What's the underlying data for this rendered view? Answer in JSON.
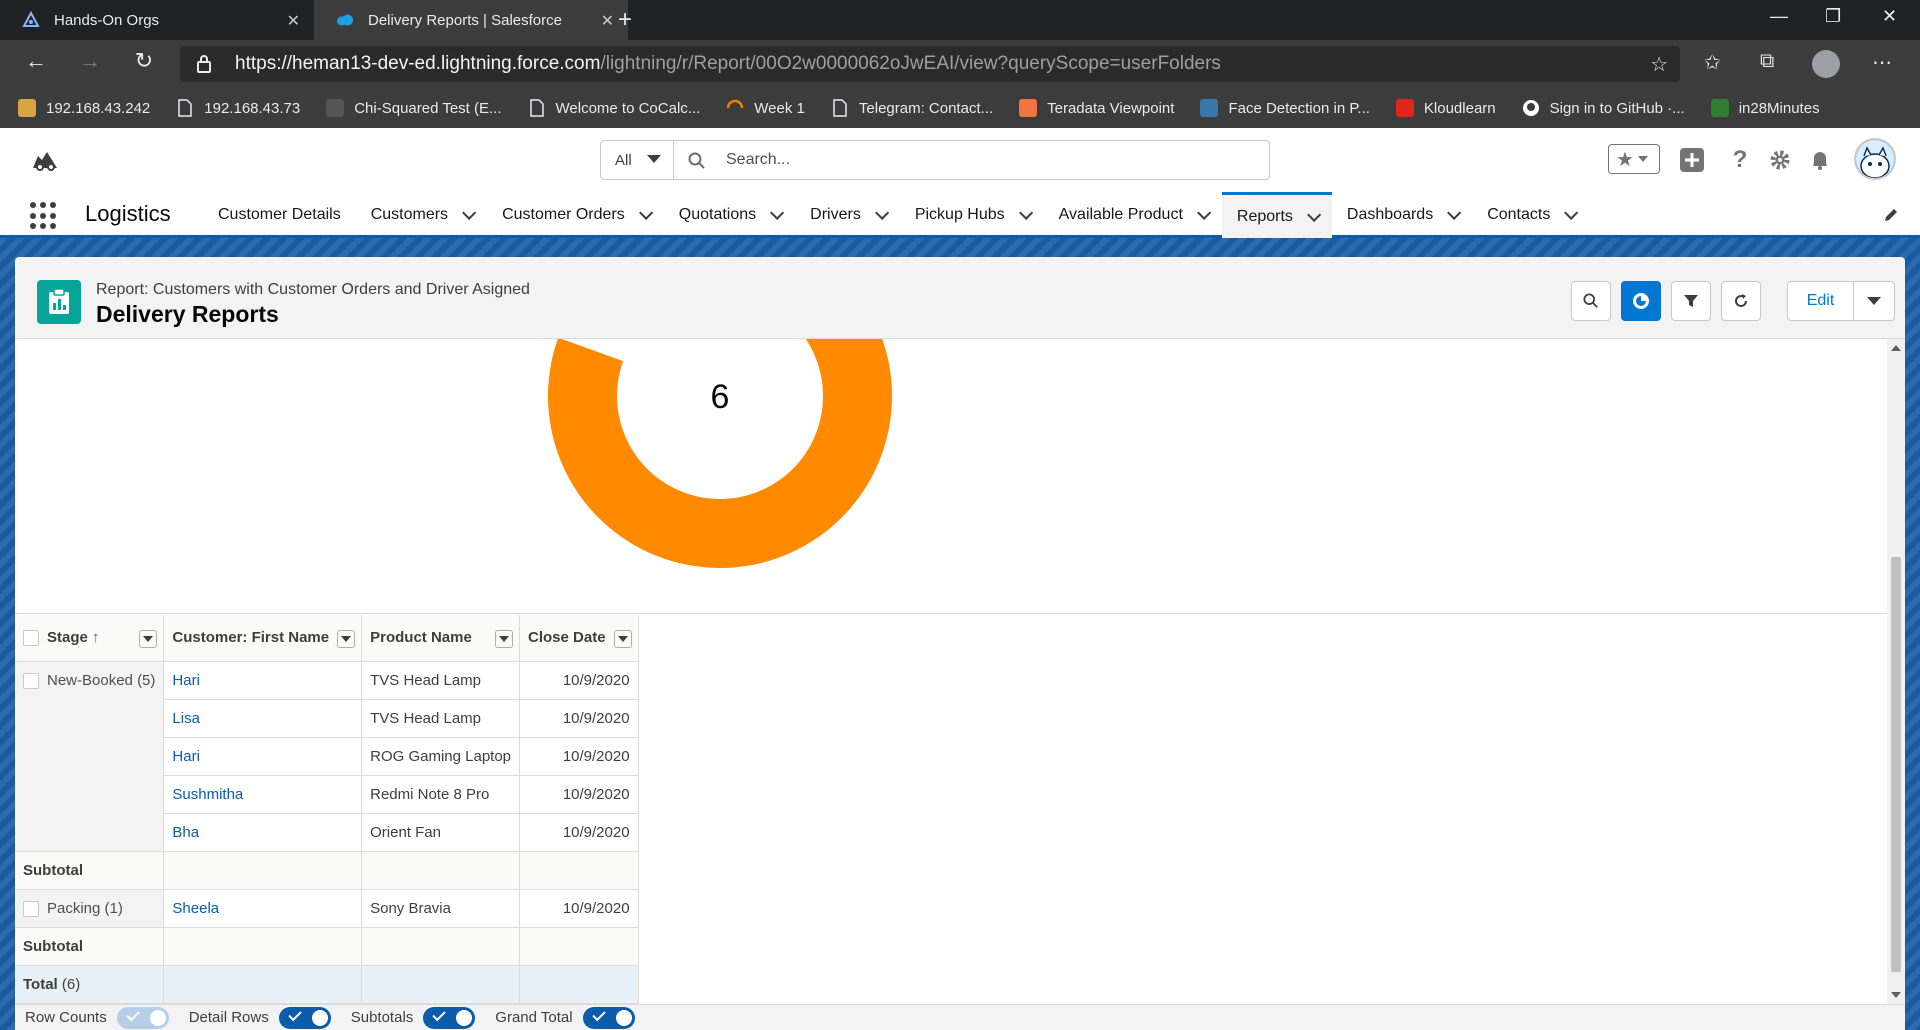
{
  "browser": {
    "tabs": [
      {
        "title": "Hands-On Orgs",
        "active": false
      },
      {
        "title": "Delivery Reports | Salesforce",
        "active": true
      }
    ],
    "url": {
      "scheme": "https://",
      "host": "heman13-dev-ed.lightning.force.com",
      "path": "/lightning/r/Report/00O2w0000062oJwEAI/view?queryScope=userFolders"
    },
    "bookmarks": [
      {
        "label": "192.168.43.242",
        "icon": "image-icon",
        "color": "#d9a441"
      },
      {
        "label": "192.168.43.73",
        "icon": "page-icon",
        "color": ""
      },
      {
        "label": "Chi-Squared Test (E...",
        "icon": "site-icon",
        "color": "#555555"
      },
      {
        "label": "Welcome to CoCalc...",
        "icon": "page-icon",
        "color": ""
      },
      {
        "label": "Week 1",
        "icon": "loading-icon",
        "color": "#f57c00"
      },
      {
        "label": "Telegram: Contact...",
        "icon": "page-icon",
        "color": ""
      },
      {
        "label": "Teradata Viewpoint",
        "icon": "teradata-icon",
        "color": "#f37440"
      },
      {
        "label": "Face Detection in P...",
        "icon": "python-icon",
        "color": "#3776ab"
      },
      {
        "label": "Kloudlearn",
        "icon": "kloudlearn-icon",
        "color": "#e1251b"
      },
      {
        "label": "Sign in to GitHub ·...",
        "icon": "github-icon",
        "color": "#ffffff"
      },
      {
        "label": "in28Minutes",
        "icon": "in28-icon",
        "color": "#2e7d32"
      }
    ]
  },
  "sf": {
    "search_scope": "All",
    "search_placeholder": "Search...",
    "app_name": "Logistics",
    "nav": [
      {
        "label": "Customer Details",
        "dropdown": false,
        "active": false
      },
      {
        "label": "Customers",
        "dropdown": true,
        "active": false
      },
      {
        "label": "Customer Orders",
        "dropdown": true,
        "active": false
      },
      {
        "label": "Quotations",
        "dropdown": true,
        "active": false
      },
      {
        "label": "Drivers",
        "dropdown": true,
        "active": false
      },
      {
        "label": "Pickup Hubs",
        "dropdown": true,
        "active": false
      },
      {
        "label": "Available Product",
        "dropdown": true,
        "active": false
      },
      {
        "label": "Reports",
        "dropdown": true,
        "active": true
      },
      {
        "label": "Dashboards",
        "dropdown": true,
        "active": false
      },
      {
        "label": "Contacts",
        "dropdown": true,
        "active": false
      }
    ],
    "accent": "#0176d3"
  },
  "report": {
    "subtitle": "Report: Customers with Customer Orders and Driver Asigned",
    "title": "Delivery Reports",
    "edit_label": "Edit",
    "chart": {
      "type": "donut",
      "center_value": "6",
      "segments": [
        {
          "name": "New-Booked",
          "value": 5,
          "color": "#ff8a00"
        },
        {
          "name": "Packing",
          "value": 1,
          "color": "#2e8ad8"
        }
      ]
    },
    "columns": [
      "Stage",
      "Customer: First Name",
      "Product Name",
      "Close Date"
    ],
    "groups": [
      {
        "stage": "New-Booked",
        "count": "(5)",
        "rows": [
          {
            "first_name": "Hari",
            "product": "TVS Head Lamp",
            "close_date": "10/9/2020"
          },
          {
            "first_name": "Lisa",
            "product": "TVS Head Lamp",
            "close_date": "10/9/2020"
          },
          {
            "first_name": "Hari",
            "product": "ROG Gaming Laptop",
            "close_date": "10/9/2020"
          },
          {
            "first_name": "Sushmitha",
            "product": "Redmi Note 8 Pro",
            "close_date": "10/9/2020"
          },
          {
            "first_name": "Bha",
            "product": "Orient Fan",
            "close_date": "10/9/2020"
          }
        ]
      },
      {
        "stage": "Packing",
        "count": "(1)",
        "rows": [
          {
            "first_name": "Sheela",
            "product": "Sony Bravia",
            "close_date": "10/9/2020"
          }
        ]
      }
    ],
    "subtotal_label": "Subtotal",
    "total_label": "Total",
    "total_count": "(6)",
    "toggles": [
      {
        "label": "Row Counts",
        "on": false
      },
      {
        "label": "Detail Rows",
        "on": true
      },
      {
        "label": "Subtotals",
        "on": true
      },
      {
        "label": "Grand Total",
        "on": true
      }
    ]
  }
}
